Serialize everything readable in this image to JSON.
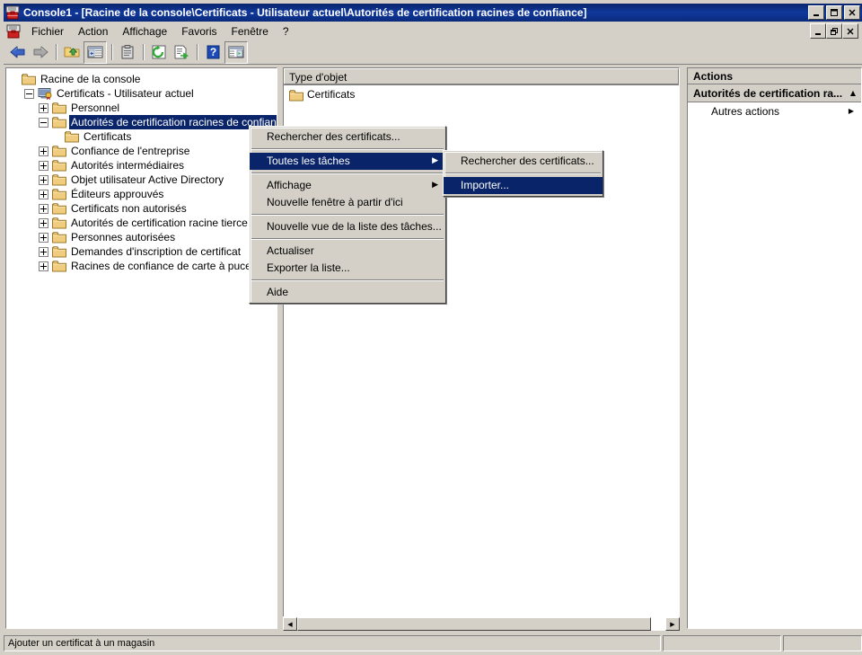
{
  "window": {
    "title": "Console1 - [Racine de la console\\Certificats - Utilisateur actuel\\Autorités de certification racines de confiance]",
    "icon": "mmc-console-icon",
    "controls": {
      "minimize": "_",
      "maximize": "□",
      "close": "✕"
    },
    "child_controls": {
      "minimize": "_",
      "restore": "❐",
      "close": "✕"
    }
  },
  "menubar": {
    "items": [
      {
        "label": "Fichier",
        "name": "menu-fichier"
      },
      {
        "label": "Action",
        "name": "menu-action"
      },
      {
        "label": "Affichage",
        "name": "menu-affichage"
      },
      {
        "label": "Favoris",
        "name": "menu-favoris"
      },
      {
        "label": "Fenêtre",
        "name": "menu-fenetre"
      },
      {
        "label": "?",
        "name": "menu-aide"
      }
    ]
  },
  "toolbar": {
    "buttons": [
      {
        "name": "back-arrow-icon",
        "tooltip": "Précédent"
      },
      {
        "name": "forward-arrow-icon",
        "tooltip": "Suivant"
      },
      {
        "name": "up-folder-icon",
        "tooltip": "Monter d'un niveau"
      },
      {
        "name": "show-hide-tree-icon",
        "tooltip": "Afficher/Masquer l'arborescence"
      },
      {
        "name": "properties-clipboard-icon",
        "tooltip": "Propriétés"
      },
      {
        "name": "refresh-icon",
        "tooltip": "Actualiser"
      },
      {
        "name": "export-list-icon",
        "tooltip": "Exporter la liste"
      },
      {
        "name": "help-icon",
        "tooltip": "Aide"
      },
      {
        "name": "show-action-pane-icon",
        "tooltip": "Afficher le volet Actions"
      }
    ]
  },
  "tree": {
    "nodes": [
      {
        "label": "Racine de la console",
        "indent": 0,
        "expander": "none",
        "icon": "folder-icon",
        "selected": false
      },
      {
        "label": "Certificats - Utilisateur actuel",
        "indent": 1,
        "expander": "minus",
        "icon": "certificate-store-icon",
        "selected": false
      },
      {
        "label": "Personnel",
        "indent": 2,
        "expander": "plus",
        "icon": "folder-icon",
        "selected": false
      },
      {
        "label": "Autorités de certification racines de confiance",
        "indent": 2,
        "expander": "minus",
        "icon": "folder-icon",
        "selected": true
      },
      {
        "label": "Certificats",
        "indent": 3,
        "expander": "none",
        "icon": "folder-icon",
        "selected": false
      },
      {
        "label": "Confiance de l'entreprise",
        "indent": 2,
        "expander": "plus",
        "icon": "folder-icon",
        "selected": false
      },
      {
        "label": "Autorités intermédiaires",
        "indent": 2,
        "expander": "plus",
        "icon": "folder-icon",
        "selected": false
      },
      {
        "label": "Objet utilisateur Active Directory",
        "indent": 2,
        "expander": "plus",
        "icon": "folder-icon",
        "selected": false
      },
      {
        "label": "Éditeurs approuvés",
        "indent": 2,
        "expander": "plus",
        "icon": "folder-icon",
        "selected": false
      },
      {
        "label": "Certificats non autorisés",
        "indent": 2,
        "expander": "plus",
        "icon": "folder-icon",
        "selected": false
      },
      {
        "label": "Autorités de certification racine tierce partie",
        "indent": 2,
        "expander": "plus",
        "icon": "folder-icon",
        "selected": false
      },
      {
        "label": "Personnes autorisées",
        "indent": 2,
        "expander": "plus",
        "icon": "folder-icon",
        "selected": false
      },
      {
        "label": "Demandes d'inscription de certificat",
        "indent": 2,
        "expander": "plus",
        "icon": "folder-icon",
        "selected": false
      },
      {
        "label": "Racines de confiance de carte à puce",
        "indent": 2,
        "expander": "plus",
        "icon": "folder-icon",
        "selected": false
      }
    ]
  },
  "list": {
    "columns": [
      "Type d'objet"
    ],
    "rows": [
      {
        "icon": "folder-icon",
        "cells": [
          "Certificats"
        ]
      }
    ],
    "hscroll": {
      "left_arrow": "◀",
      "right_arrow": "▶"
    }
  },
  "actions": {
    "title": "Actions",
    "group": {
      "label": "Autorités de certification ra...",
      "collapse_glyph": "▲"
    },
    "items": [
      {
        "label": "Autres actions",
        "submenu_glyph": "▶"
      }
    ]
  },
  "context_menu": {
    "items": [
      {
        "label": "Rechercher des certificats...",
        "type": "item",
        "highlighted": false,
        "submenu": false
      },
      {
        "type": "separator"
      },
      {
        "label": "Toutes les tâches",
        "type": "item",
        "highlighted": true,
        "submenu": true,
        "arrow": "▶"
      },
      {
        "type": "separator"
      },
      {
        "label": "Affichage",
        "type": "item",
        "highlighted": false,
        "submenu": true,
        "arrow": "▶"
      },
      {
        "label": "Nouvelle fenêtre à partir d'ici",
        "type": "item",
        "highlighted": false,
        "submenu": false
      },
      {
        "type": "separator"
      },
      {
        "label": "Nouvelle vue de la liste des tâches...",
        "type": "item",
        "highlighted": false,
        "submenu": false
      },
      {
        "type": "separator"
      },
      {
        "label": "Actualiser",
        "type": "item",
        "highlighted": false,
        "submenu": false
      },
      {
        "label": "Exporter la liste...",
        "type": "item",
        "highlighted": false,
        "submenu": false
      },
      {
        "type": "separator"
      },
      {
        "label": "Aide",
        "type": "item",
        "highlighted": false,
        "submenu": false
      }
    ]
  },
  "context_submenu": {
    "items": [
      {
        "label": "Rechercher des certificats...",
        "type": "item",
        "highlighted": false
      },
      {
        "type": "separator"
      },
      {
        "label": "Importer...",
        "type": "item",
        "highlighted": true
      }
    ]
  },
  "statusbar": {
    "main": "Ajouter un certificat à un magasin",
    "middle": "",
    "right": ""
  },
  "colors": {
    "titlebar_blue": "#0a246a",
    "selection_blue": "#0a246a",
    "face": "#d4d0c8",
    "folder_yellow": "#f5d98b",
    "window_white": "#ffffff"
  }
}
